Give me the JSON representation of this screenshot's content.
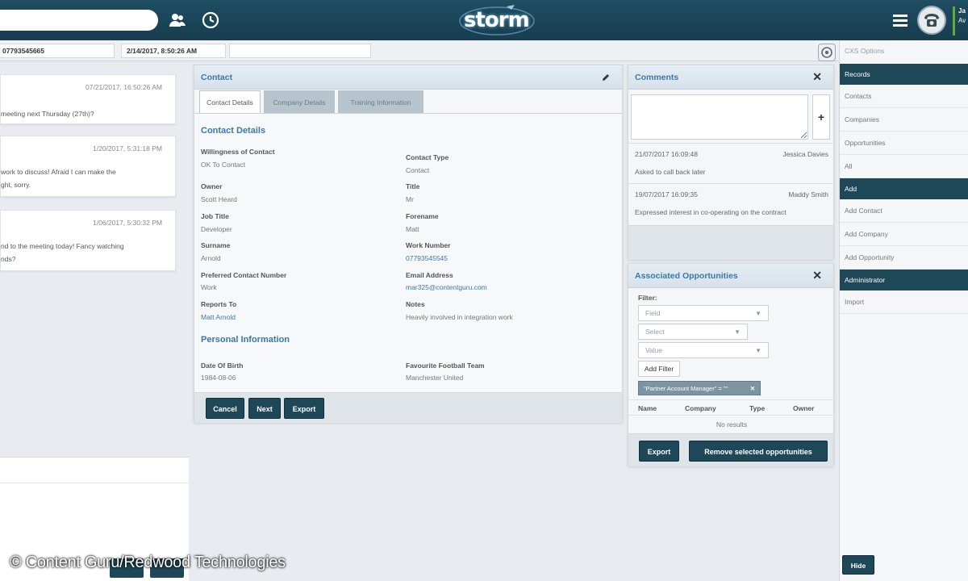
{
  "topbar": {
    "logo": "storm"
  },
  "user": {
    "initials": "Ja",
    "sub": "Av"
  },
  "info_strip": {
    "phone": "07793545665",
    "datetime": "2/14/2017, 8:50:26 AM"
  },
  "messages": [
    {
      "timestamp": "07/21/2017, 16:50:26 AM",
      "text": "meeting next Thursday (27th)?"
    },
    {
      "timestamp": "1/20/2017, 5:31:18 PM",
      "text": "work to discuss! Afraid I can make the\nght, sorry."
    },
    {
      "timestamp": "1/06/2017, 5:30:32 PM",
      "text": "nd to the meeting today! Fancy watching\nnds?"
    }
  ],
  "contact_panel": {
    "title": "Contact",
    "tabs": [
      "Contact Details",
      "Company Details",
      "Training Information"
    ],
    "section_contact": "Contact Details",
    "section_personal": "Personal Information",
    "fields_left": [
      {
        "label": "Willingness of Contact",
        "value": "OK To Contact"
      },
      {
        "label": "Owner",
        "value": "Scott Heard"
      },
      {
        "label": "Job Title",
        "value": "Developer"
      },
      {
        "label": "Surname",
        "value": "Arnold"
      },
      {
        "label": "Preferred Contact Number",
        "value": "Work"
      },
      {
        "label": "Reports To",
        "value": "Matt Arnold"
      }
    ],
    "fields_right": [
      {
        "label": "Contact Type",
        "value": "Contact"
      },
      {
        "label": "Title",
        "value": "Mr"
      },
      {
        "label": "Forename",
        "value": "Matt"
      },
      {
        "label": "Work Number",
        "value": "07793545545"
      },
      {
        "label": "Email Address",
        "value": "mar325@contentguru.com"
      },
      {
        "label": "Notes",
        "value": "Heavily involved in integration work"
      }
    ],
    "personal": [
      {
        "label": "Date Of Birth",
        "value": "1984-08-06"
      },
      {
        "label": "Favourite Football Team",
        "value": "Manchester United"
      }
    ],
    "buttons": {
      "cancel": "Cancel",
      "next": "Next",
      "export": "Export"
    }
  },
  "comments_panel": {
    "title": "Comments",
    "items": [
      {
        "date": "21/07/2017 16:09:48",
        "author": "Jessica Davies",
        "text": "Asked to call back later"
      },
      {
        "date": "19/07/2017 16:09:35",
        "author": "Maddy Smith",
        "text": "Expressed interest in co-operating on the contract"
      }
    ]
  },
  "opps_panel": {
    "title": "Associated Opportunities",
    "filter_label": "Filter:",
    "field_placeholder": "Field",
    "select_placeholder": "Select",
    "value_placeholder": "Value",
    "add_filter": "Add Filter",
    "active_filter": "\"Partner Account Manager\" = \"\"",
    "columns": [
      "Name",
      "Company",
      "Type",
      "Owner"
    ],
    "empty": "No results",
    "buttons": {
      "export": "Export",
      "remove": "Remove selected opportunities"
    }
  },
  "sidebar": {
    "options_title": "CXS Options",
    "groups": [
      {
        "header": "Records",
        "items": [
          "Contacts",
          "Companies",
          "Opportunities",
          "All"
        ]
      },
      {
        "header": "Add",
        "items": [
          "Add Contact",
          "Add Company",
          "Add Opportunity"
        ]
      },
      {
        "header": "Administrator",
        "items": [
          "Import"
        ]
      }
    ],
    "hide": "Hide"
  },
  "copyright": "© Content Guru/Redwood Technologies",
  "colors": {
    "header": "#1f4d62",
    "accent": "#3a78a8",
    "button": "#1e4858"
  }
}
